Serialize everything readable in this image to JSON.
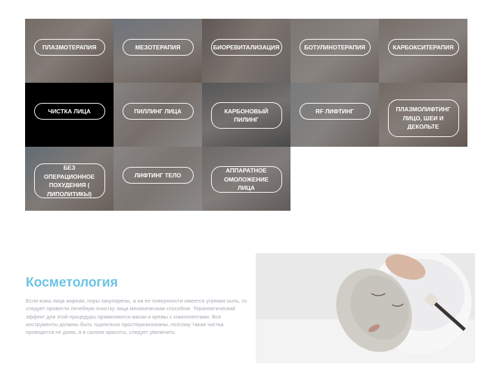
{
  "services": [
    {
      "label": "ПЛАЗМОТЕРАПИЯ"
    },
    {
      "label": "МЕЗОТЕРАПИЯ"
    },
    {
      "label": "БИОРЕВИТАЛИЗАЦИЯ"
    },
    {
      "label": "БОТУЛИНОТЕРАПИЯ"
    },
    {
      "label": "КАРБОКСИТЕРАПИЯ"
    },
    {
      "label": "ЧИСТКА ЛИЦА"
    },
    {
      "label": "ПИЛЛИНГ ЛИЦА"
    },
    {
      "label": "КАРБОНОВЫЙ ПИЛИНГ"
    },
    {
      "label": "RF ЛИФТИНГ"
    },
    {
      "label": "ПЛАЗМОЛИФТИНГ ЛИЦО, ШЕИ И ДЕКОЛЬТЕ"
    },
    {
      "label": "БЕЗ ОПЕРАЦИОННОЕ ПОХУДЕНИЯ ( ЛИПОЛИТИКЫ)"
    },
    {
      "label": "ЛИФТИНГ ТЕЛО"
    },
    {
      "label": "АППАРАТНОЕ ОМОЛОЖЕНИЕ ЛИЦА"
    }
  ],
  "section": {
    "title": "Косметология",
    "text": "Если кожа лица жирная, поры закупорены, а на ее поверхности имеется угревая сыпь, то следует провести лечебную очистку лица механическим способом. Терапевтический эффект для этой процедуры применяются маски и кремы с компонентами. Все инструменты должны быть тщательно простерилизованы, поэтому такая чистка проводится не дома, а в салоне красоты, следует увеличить."
  },
  "colors": {
    "accent": "#6ec3e3",
    "body_text": "#a7a7b4",
    "tile_overlay": "#2a2a2a"
  }
}
